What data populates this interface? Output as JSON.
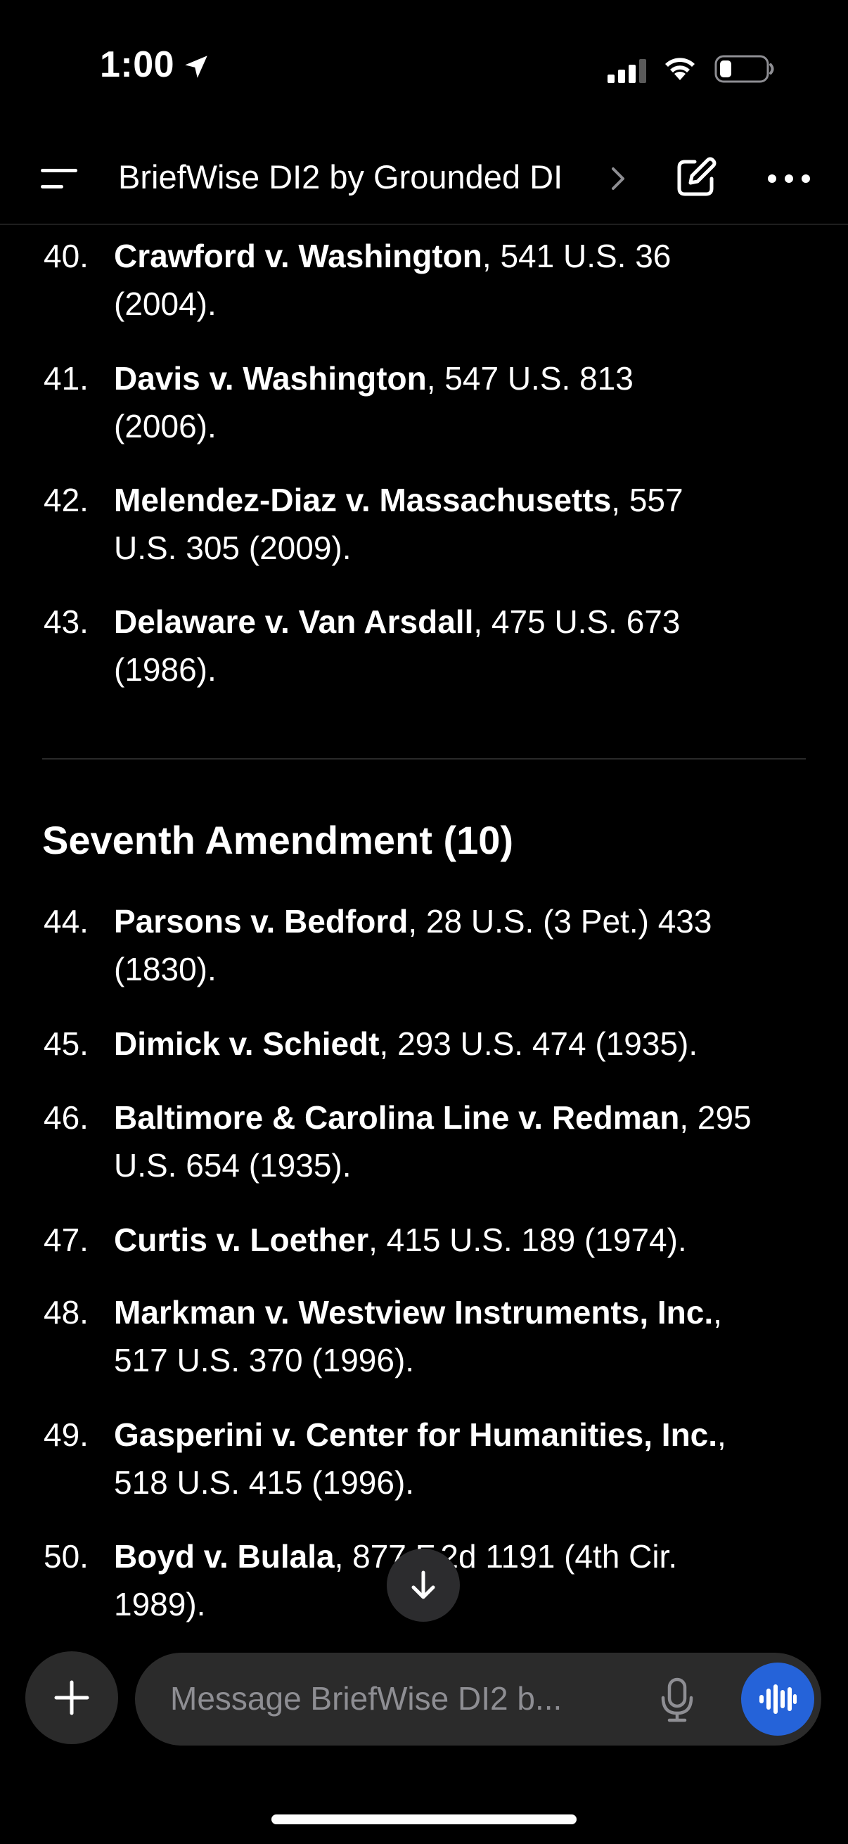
{
  "status_bar": {
    "time": "1:00",
    "icons": [
      "location-arrow-icon",
      "cellular-signal-icon",
      "wifi-icon",
      "battery-icon"
    ]
  },
  "header": {
    "title": "BriefWise DI2 by Grounded DI",
    "icons": [
      "menu-icon",
      "chevron-right-icon",
      "edit-icon",
      "more-icon"
    ]
  },
  "citations_top": [
    {
      "number": "40.",
      "case": "Crawford v. Washington",
      "line1_rest": ", 541 U.S. 36",
      "line2": "(2004)."
    },
    {
      "number": "41.",
      "case": "Davis v. Washington",
      "line1_rest": ", 547 U.S. 813",
      "line2": "(2006)."
    },
    {
      "number": "42.",
      "case": "Melendez-Diaz v. Massachusetts",
      "line1_rest": ", 557",
      "line2": "U.S. 305 (2009)."
    },
    {
      "number": "43.",
      "case": "Delaware v. Van Arsdall",
      "line1_rest": ", 475 U.S. 673",
      "line2": "(1986)."
    }
  ],
  "section": {
    "heading": "Seventh Amendment (10)"
  },
  "citations_section": [
    {
      "number": "44.",
      "case": "Parsons v. Bedford",
      "line1_rest": ", 28 U.S. (3 Pet.) 433",
      "line2": "(1830)."
    },
    {
      "number": "45.",
      "case": "Dimick v. Schiedt",
      "line1_rest": ", 293 U.S. 474 (1935).",
      "line2": ""
    },
    {
      "number": "46.",
      "case": "Baltimore & Carolina Line v. Redman",
      "line1_rest": ", 295",
      "line2": "U.S. 654 (1935)."
    },
    {
      "number": "47.",
      "case": "Curtis v. Loether",
      "line1_rest": ", 415 U.S. 189 (1974).",
      "line2": ""
    },
    {
      "number": "48.",
      "case": "Markman v. Westview Instruments, Inc.",
      "line1_rest": ",",
      "line2": "517 U.S. 370 (1996)."
    },
    {
      "number": "49.",
      "case": "Gasperini v. Center for Humanities, Inc.",
      "line1_rest": ",",
      "line2": "518 U.S. 415 (1996)."
    },
    {
      "number": "50.",
      "case": "Boyd v. Bulala",
      "line1_rest": ", 877 F.2d 1191 (4th Cir.",
      "line2": "1989)."
    }
  ],
  "scroll_button": {
    "icon": "arrow-down-icon"
  },
  "composer": {
    "placeholder": "Message BriefWise DI2 b...",
    "plus_icon": "plus-icon",
    "mic_icon": "microphone-icon",
    "voice_icon": "voice-waveform-icon",
    "accent_color": "#2563d9"
  }
}
